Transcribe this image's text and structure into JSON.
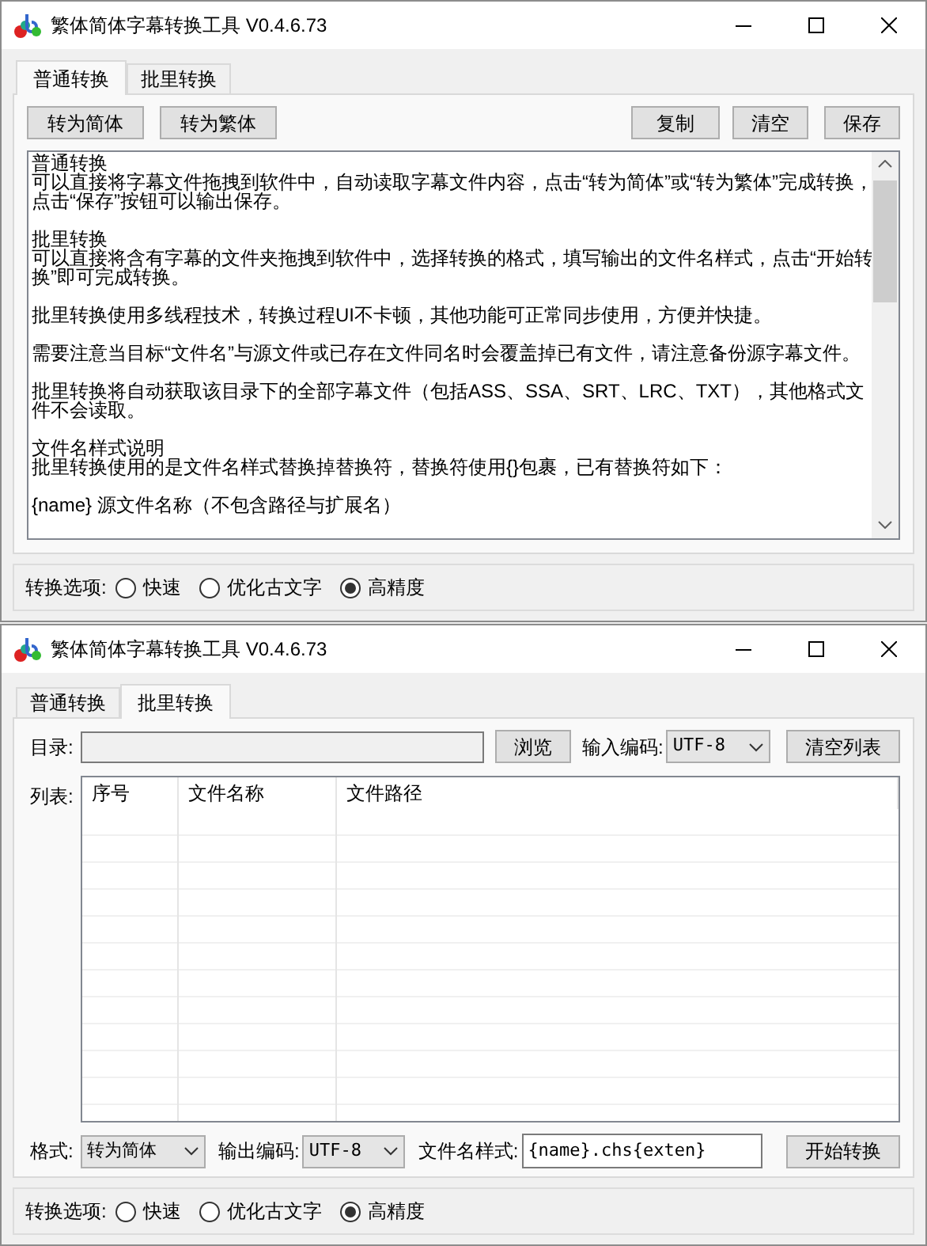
{
  "windows": [
    {
      "title": "繁体简体字幕转换工具 V0.4.6.73",
      "tabs": [
        {
          "label": "普通转换",
          "selected": true
        },
        {
          "label": "批里转换",
          "selected": false
        }
      ],
      "page": {
        "kind": "single",
        "left_buttons": [
          "转为简体",
          "转为繁体"
        ],
        "right_buttons": [
          "复制",
          "清空",
          "保存"
        ],
        "text_blocks": [
          {
            "lines": [
              "普通转换",
              "可以直接将字幕文件拖拽到软件中，自动读取字幕文件内容，点击“转为简体”或“转为繁体”完成转换，点击“保存”按钮可以输出保存。"
            ]
          },
          {
            "lines": [
              "批里转换",
              "可以直接将含有字幕的文件夹拖拽到软件中，选择转换的格式，填写输出的文件名样式，点击“开始转换”即可完成转换。"
            ]
          },
          {
            "lines": [
              "批里转换使用多线程技术，转换过程UI不卡顿，其他功能可正常同步使用，方便并快捷。"
            ]
          },
          {
            "lines": [
              "需要注意当目标“文件名”与源文件或已存在文件同名时会覆盖掉已有文件，请注意备份源字幕文件。"
            ]
          },
          {
            "lines": [
              "批里转换将自动获取该目录下的全部字幕文件（包括ASS、SSA、SRT、LRC、TXT），其他格式文件不会读取。"
            ]
          },
          {
            "lines": [
              "文件名样式说明",
              "批里转换使用的是文件名样式替换掉替换符，替换符使用{}包裹，已有替换符如下："
            ]
          },
          {
            "lines": [
              "{name} 源文件名称（不包含路径与扩展名）"
            ]
          }
        ]
      },
      "options": {
        "label": "转换选项:",
        "radios": [
          {
            "label": "快速",
            "selected": false
          },
          {
            "label": "优化古文字",
            "selected": false
          },
          {
            "label": "高精度",
            "selected": true
          }
        ]
      }
    },
    {
      "title": "繁体简体字幕转换工具 V0.4.6.73",
      "tabs": [
        {
          "label": "普通转换",
          "selected": false
        },
        {
          "label": "批里转换",
          "selected": true
        }
      ],
      "page": {
        "kind": "batch",
        "directory_label": "目录:",
        "browse_button": "浏览",
        "input_encoding_label": "输入编码:",
        "input_encoding": "UTF-8",
        "clear_list_button": "清空列表",
        "list_label": "列表:",
        "columns": [
          "序号",
          "文件名称",
          "文件路径"
        ],
        "format_label": "格式:",
        "format": "转为简体",
        "output_encoding_label": "输出编码:",
        "output_encoding": "UTF-8",
        "name_pattern_label": "文件名样式:",
        "name_pattern": "{name}.chs{exten}",
        "start_button": "开始转换"
      },
      "options": {
        "label": "转换选项:",
        "radios": [
          {
            "label": "快速",
            "selected": false
          },
          {
            "label": "优化古文字",
            "selected": false
          },
          {
            "label": "高精度",
            "selected": true
          }
        ]
      }
    }
  ]
}
